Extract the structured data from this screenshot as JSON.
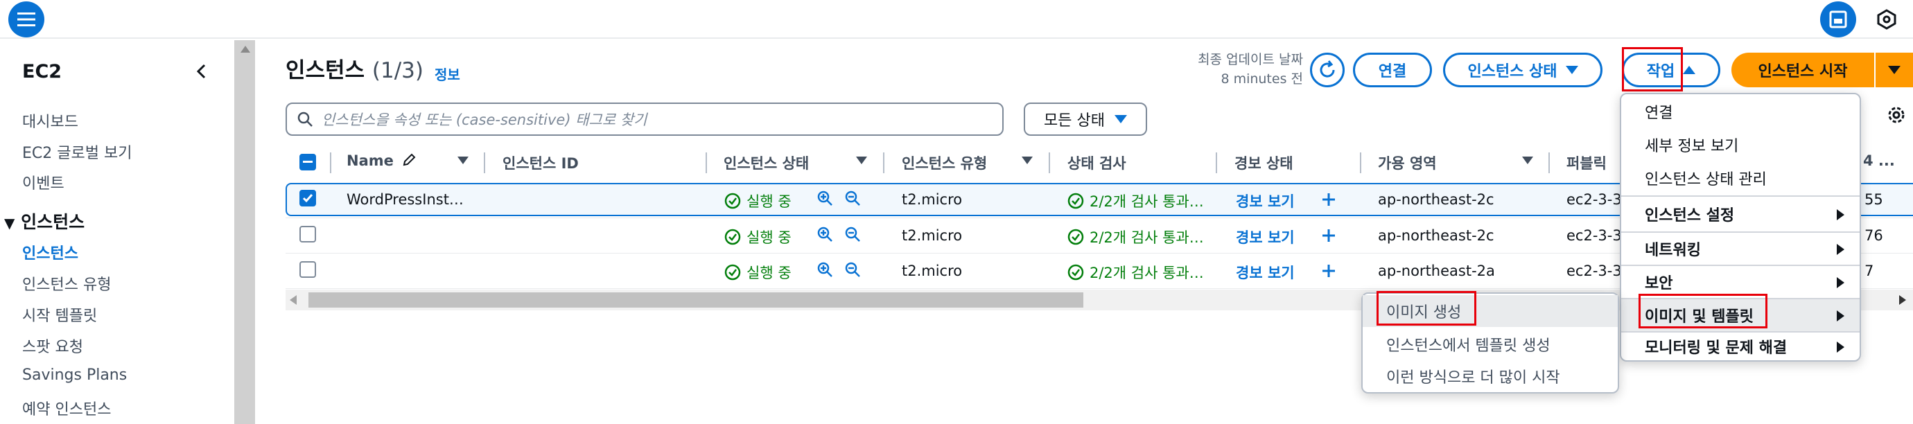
{
  "sidebar": {
    "title": "EC2",
    "items": [
      "대시보드",
      "EC2 글로벌 보기",
      "이벤트"
    ],
    "section": "인스턴스",
    "section_items": [
      "인스턴스",
      "인스턴스 유형",
      "시작 템플릿",
      "스팟 요청",
      "Savings Plans",
      "예약 인스턴스"
    ]
  },
  "header": {
    "title": "인스턴스",
    "count": "(1/3)",
    "info": "정보",
    "last_updated_label": "최종 업데이트 날짜",
    "last_updated_value": "8 minutes 전",
    "connect_label": "연결",
    "state_label": "인스턴스 상태",
    "actions_label": "작업",
    "launch_label": "인스턴스 시작"
  },
  "search": {
    "placeholder": "인스턴스을 속성 또는 (case-sensitive) 태그로 찾기"
  },
  "state_filter": "모든 상태",
  "table": {
    "columns": [
      "Name",
      "인스턴스 ID",
      "인스턴스 상태",
      "인스턴스 유형",
      "상태 검사",
      "경보 상태",
      "가용 영역",
      "퍼블릭",
      "4 ..."
    ],
    "rows": [
      {
        "name": "WordPressInst…",
        "state": "실행 중",
        "type": "t2.micro",
        "check": "2/2개 검사 통과…",
        "alarm": "경보 보기",
        "zone": "ap-northeast-2c",
        "dns": "ec2-3-3",
        "tail": "55",
        "selected": true
      },
      {
        "name": "",
        "state": "실행 중",
        "type": "t2.micro",
        "check": "2/2개 검사 통과…",
        "alarm": "경보 보기",
        "zone": "ap-northeast-2c",
        "dns": "ec2-3-3",
        "tail": "76",
        "selected": false
      },
      {
        "name": "",
        "state": "실행 중",
        "type": "t2.micro",
        "check": "2/2개 검사 통과…",
        "alarm": "경보 보기",
        "zone": "ap-northeast-2a",
        "dns": "ec2-3-3",
        "tail": "7",
        "selected": false
      }
    ]
  },
  "actions_menu": {
    "items": [
      "연결",
      "세부 정보 보기",
      "인스턴스 상태 관리"
    ],
    "groups": [
      "인스턴스 설정",
      "네트워킹",
      "보안",
      "이미지 및 템플릿",
      "모니터링 및 문제 해결"
    ]
  },
  "submenu": {
    "items": [
      "이미지 생성",
      "인스턴스에서 템플릿 생성",
      "이런 방식으로 더 많이 시작"
    ]
  },
  "colors": {
    "primary": "#0972d3",
    "launch": "#ff9900",
    "success": "#037f0c",
    "highlight": "#e8000a"
  }
}
